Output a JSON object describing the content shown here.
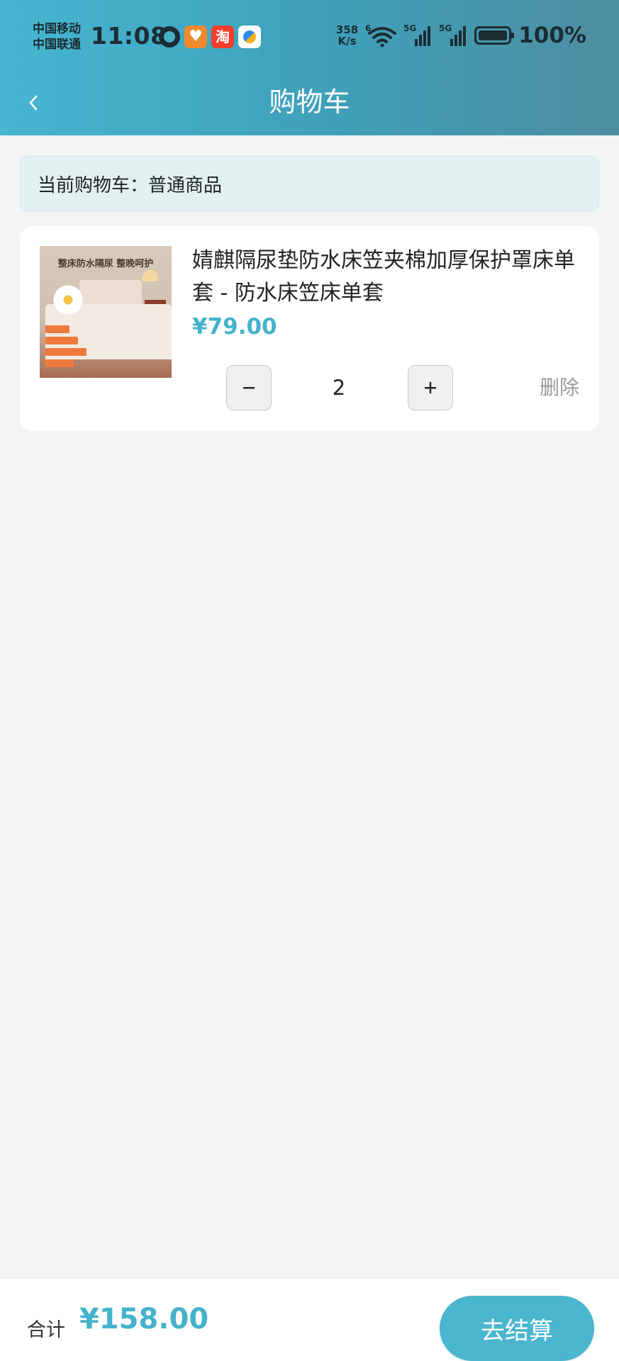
{
  "status_bar": {
    "carrier_1": "中国移动",
    "carrier_2": "中国联通",
    "time": "11:08",
    "net_speed_value": "358",
    "net_speed_unit": "K/s",
    "wifi_badge": "6",
    "signal_1_label": "5G",
    "signal_2_label": "5G",
    "battery_level": 100,
    "battery_text": "100%",
    "app_icons": [
      "alarm-icon",
      "health-app-icon",
      "taobao-app-icon",
      "pay-app-icon"
    ]
  },
  "header": {
    "back_icon": "chevron-left-icon",
    "title": "购物车"
  },
  "cart_banner": {
    "text": "当前购物车：普通商品"
  },
  "cart_items": [
    {
      "title": "婧麒隔尿垫防水床笠夹棉加厚保护罩床单套 - 防水床笠床单套",
      "image_caption": "整床防水隔尿 整晚呵护",
      "price": "¥79.00",
      "quantity": "2",
      "minus_label": "−",
      "plus_label": "+",
      "delete_label": "删除"
    }
  ],
  "footer": {
    "total_label": "合计",
    "total_amount": "¥158.00",
    "checkout_label": "去结算"
  },
  "colors": {
    "accent": "#45b2cb",
    "header_start": "#46b6d1",
    "header_end": "#4e8ea1",
    "banner_bg": "#e2f1f2",
    "page_bg": "#f4f4f5"
  }
}
